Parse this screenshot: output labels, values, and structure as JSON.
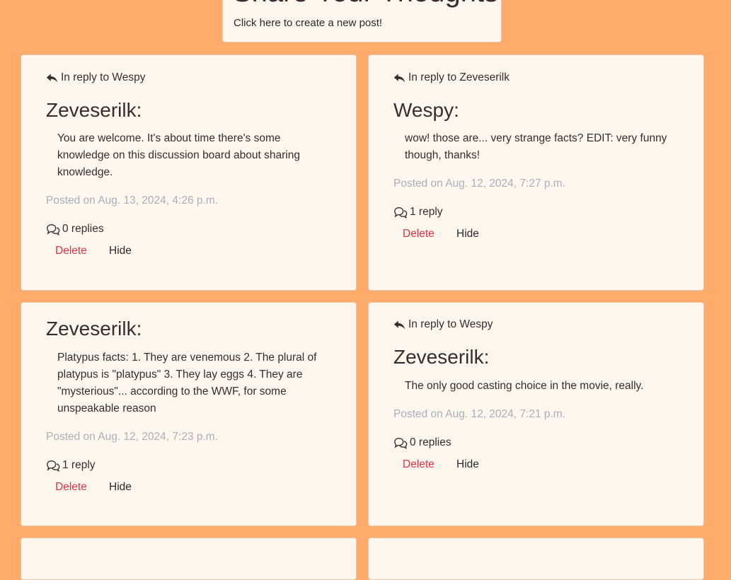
{
  "header": {
    "title": "Share Your Thoughts",
    "create_link": "Click here to create a new post!"
  },
  "posts": [
    {
      "reply_to": "In reply to Wespy",
      "author": "Zeveserilk:",
      "body_lines": [
        "You are welcome. It's about time there's some",
        "knowledge on this discussion board about sharing",
        "knowledge."
      ],
      "posted": "Posted on Aug. 13, 2024, 4:26 p.m.",
      "replies": "0 replies",
      "delete_label": "Delete",
      "hide_label": "Hide"
    },
    {
      "reply_to": "In reply to Zeveserilk",
      "author": "Wespy:",
      "body_lines": [
        "wow! those are... very strange facts? EDIT: very funny",
        "though, thanks!"
      ],
      "posted": "Posted on Aug. 12, 2024, 7:27 p.m.",
      "replies": "1 reply",
      "delete_label": "Delete",
      "hide_label": "Hide"
    },
    {
      "reply_to": "",
      "author": "Zeveserilk:",
      "body_lines": [
        "Platypus facts: 1. They are venemous 2. The plural of",
        "platypus is \"platypus\" 3. They lay eggs 4. They are",
        "\"mysterious\"... according to the WWF, for some",
        "unspeakable reason"
      ],
      "posted": "Posted on Aug. 12, 2024, 7:23 p.m.",
      "replies": "1 reply",
      "delete_label": "Delete",
      "hide_label": "Hide"
    },
    {
      "reply_to": "In reply to Wespy",
      "author": "Zeveserilk:",
      "body_lines": [
        "The only good casting choice in the movie, really."
      ],
      "posted": "Posted on Aug. 12, 2024, 7:21 p.m.",
      "replies": "0 replies",
      "delete_label": "Delete",
      "hide_label": "Hide"
    }
  ],
  "icons": {
    "reply": "reply-icon",
    "comments": "comments-icon"
  },
  "colors": {
    "background": "#ffab6b",
    "card": "#fff6ee",
    "delete": "#dc3545",
    "posted": "#a8b0bd"
  }
}
